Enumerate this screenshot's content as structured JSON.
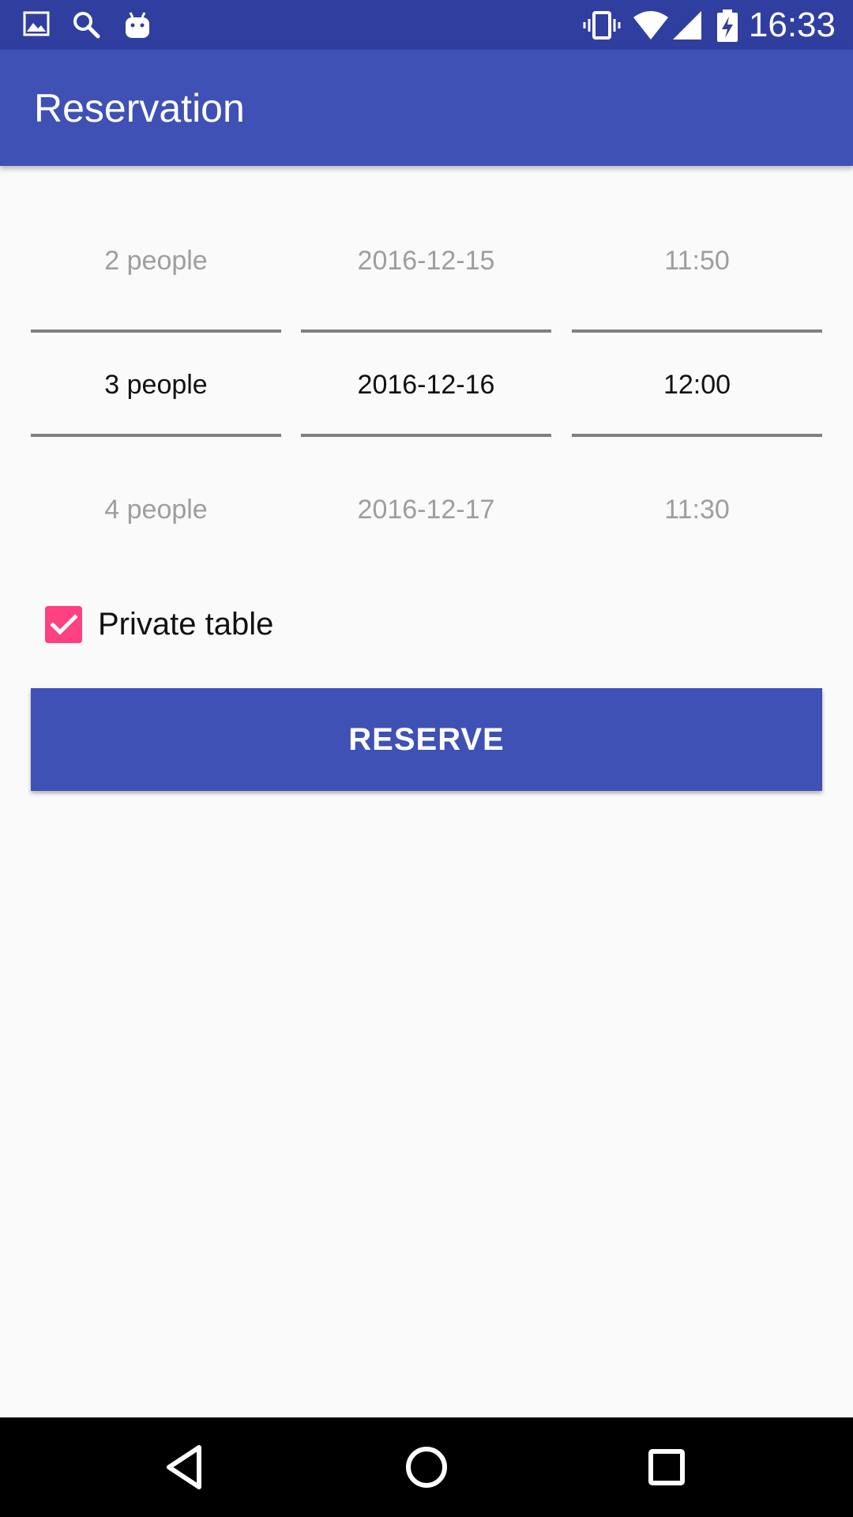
{
  "status_bar": {
    "time": "16:33",
    "left_icons": [
      "image-icon",
      "search-icon",
      "android-icon"
    ],
    "right_icons": [
      "vibrate-icon",
      "wifi-icon",
      "signal-icon",
      "battery-charging-icon"
    ]
  },
  "app_bar": {
    "title": "Reservation"
  },
  "pickers": {
    "people": {
      "prev": "2 people",
      "selected": "3 people",
      "next": "4 people"
    },
    "date": {
      "prev": "2016-12-15",
      "selected": "2016-12-16",
      "next": "2016-12-17"
    },
    "time": {
      "prev": "11:50",
      "selected": "12:00",
      "next": "11:30"
    }
  },
  "private_table": {
    "label": "Private table",
    "checked": true
  },
  "reserve_button": {
    "label": "RESERVE"
  },
  "colors": {
    "status_bar": "#303f9f",
    "primary": "#3f51b5",
    "accent": "#ff4081",
    "background": "#fafafa"
  },
  "nav_bar": {
    "buttons": [
      "back-icon",
      "home-icon",
      "recents-icon"
    ]
  }
}
